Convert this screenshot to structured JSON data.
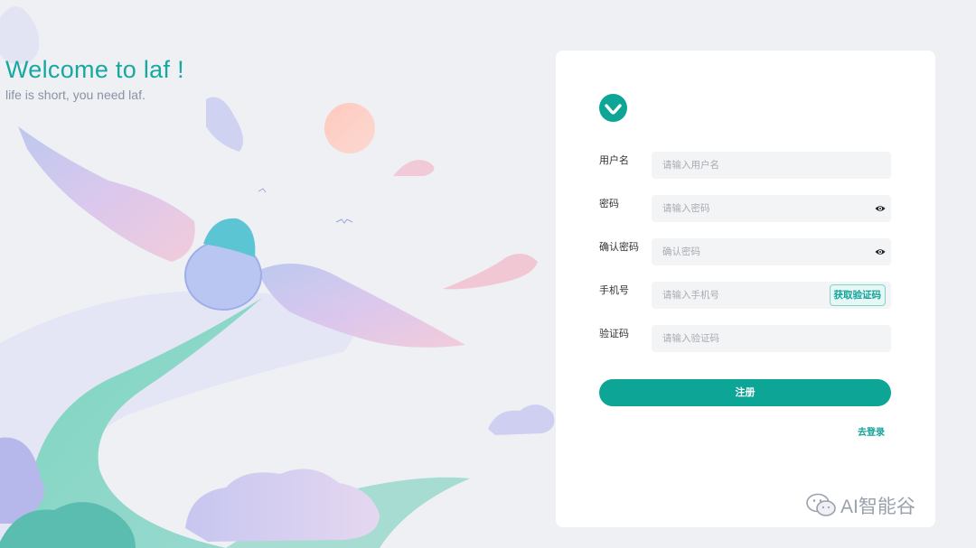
{
  "hero": {
    "title": "Welcome to laf !",
    "subtitle": "life is short, you need laf."
  },
  "form": {
    "username": {
      "label": "用户名",
      "placeholder": "请输入用户名"
    },
    "password": {
      "label": "密码",
      "placeholder": "请输入密码"
    },
    "confirm_password": {
      "label": "确认密码",
      "placeholder": "确认密码"
    },
    "phone": {
      "label": "手机号",
      "placeholder": "请输入手机号",
      "get_code_label": "获取验证码"
    },
    "code": {
      "label": "验证码",
      "placeholder": "请输入验证码"
    },
    "submit_label": "注册",
    "login_link": "去登录"
  },
  "watermark": {
    "text": "AI智能谷"
  },
  "colors": {
    "accent": "#0da596",
    "title": "#17a8a0",
    "background": "#eef0f4",
    "card": "#ffffff",
    "input_bg": "#f3f4f6"
  }
}
